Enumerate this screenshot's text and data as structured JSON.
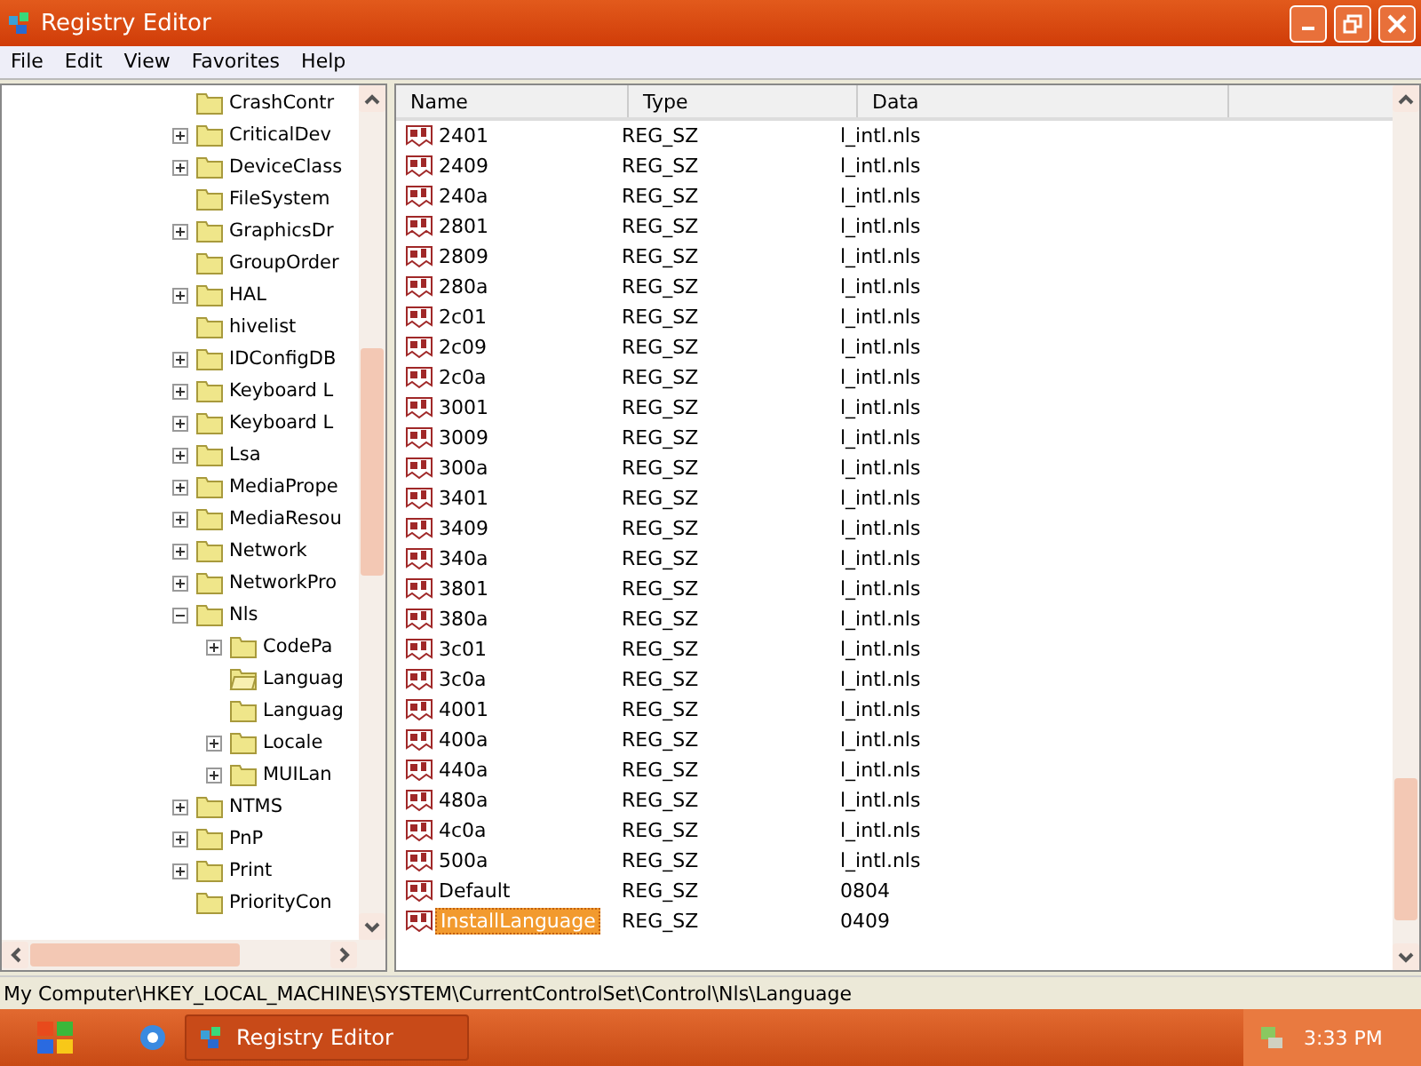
{
  "window": {
    "title": "Registry Editor"
  },
  "menu": [
    "File",
    "Edit",
    "View",
    "Favorites",
    "Help"
  ],
  "tree": [
    {
      "label": "CrashContr",
      "kind": "leaf"
    },
    {
      "label": "CriticalDev",
      "kind": "node",
      "expanded": false
    },
    {
      "label": "DeviceClass",
      "kind": "node",
      "expanded": false
    },
    {
      "label": "FileSystem",
      "kind": "leaf"
    },
    {
      "label": "GraphicsDr",
      "kind": "node",
      "expanded": false
    },
    {
      "label": "GroupOrder",
      "kind": "leaf"
    },
    {
      "label": "HAL",
      "kind": "node",
      "expanded": false
    },
    {
      "label": "hivelist",
      "kind": "leaf"
    },
    {
      "label": "IDConfigDB",
      "kind": "node",
      "expanded": false
    },
    {
      "label": "Keyboard L",
      "kind": "node",
      "expanded": false
    },
    {
      "label": "Keyboard L",
      "kind": "node",
      "expanded": false
    },
    {
      "label": "Lsa",
      "kind": "node",
      "expanded": false
    },
    {
      "label": "MediaPrope",
      "kind": "node",
      "expanded": false
    },
    {
      "label": "MediaResou",
      "kind": "node",
      "expanded": false
    },
    {
      "label": "Network",
      "kind": "node",
      "expanded": false
    },
    {
      "label": "NetworkPro",
      "kind": "node",
      "expanded": false
    },
    {
      "label": "Nls",
      "kind": "node",
      "expanded": true,
      "children": [
        {
          "label": "CodePa",
          "kind": "node",
          "expanded": false
        },
        {
          "label": "Languag",
          "kind": "leaf",
          "open": true
        },
        {
          "label": "Languag",
          "kind": "leaf"
        },
        {
          "label": "Locale",
          "kind": "node",
          "expanded": false
        },
        {
          "label": "MUILan",
          "kind": "node",
          "expanded": false
        }
      ]
    },
    {
      "label": "NTMS",
      "kind": "node",
      "expanded": false
    },
    {
      "label": "PnP",
      "kind": "node",
      "expanded": false
    },
    {
      "label": "Print",
      "kind": "node",
      "expanded": false
    },
    {
      "label": "PriorityCon",
      "kind": "leaf"
    }
  ],
  "columns": [
    "Name",
    "Type",
    "Data"
  ],
  "rows": [
    {
      "name": "2401",
      "type": "REG_SZ",
      "data": "l_intl.nls",
      "selected": false
    },
    {
      "name": "2409",
      "type": "REG_SZ",
      "data": "l_intl.nls",
      "selected": false
    },
    {
      "name": "240a",
      "type": "REG_SZ",
      "data": "l_intl.nls",
      "selected": false
    },
    {
      "name": "2801",
      "type": "REG_SZ",
      "data": "l_intl.nls",
      "selected": false
    },
    {
      "name": "2809",
      "type": "REG_SZ",
      "data": "l_intl.nls",
      "selected": false
    },
    {
      "name": "280a",
      "type": "REG_SZ",
      "data": "l_intl.nls",
      "selected": false
    },
    {
      "name": "2c01",
      "type": "REG_SZ",
      "data": "l_intl.nls",
      "selected": false
    },
    {
      "name": "2c09",
      "type": "REG_SZ",
      "data": "l_intl.nls",
      "selected": false
    },
    {
      "name": "2c0a",
      "type": "REG_SZ",
      "data": "l_intl.nls",
      "selected": false
    },
    {
      "name": "3001",
      "type": "REG_SZ",
      "data": "l_intl.nls",
      "selected": false
    },
    {
      "name": "3009",
      "type": "REG_SZ",
      "data": "l_intl.nls",
      "selected": false
    },
    {
      "name": "300a",
      "type": "REG_SZ",
      "data": "l_intl.nls",
      "selected": false
    },
    {
      "name": "3401",
      "type": "REG_SZ",
      "data": "l_intl.nls",
      "selected": false
    },
    {
      "name": "3409",
      "type": "REG_SZ",
      "data": "l_intl.nls",
      "selected": false
    },
    {
      "name": "340a",
      "type": "REG_SZ",
      "data": "l_intl.nls",
      "selected": false
    },
    {
      "name": "3801",
      "type": "REG_SZ",
      "data": "l_intl.nls",
      "selected": false
    },
    {
      "name": "380a",
      "type": "REG_SZ",
      "data": "l_intl.nls",
      "selected": false
    },
    {
      "name": "3c01",
      "type": "REG_SZ",
      "data": "l_intl.nls",
      "selected": false
    },
    {
      "name": "3c0a",
      "type": "REG_SZ",
      "data": "l_intl.nls",
      "selected": false
    },
    {
      "name": "4001",
      "type": "REG_SZ",
      "data": "l_intl.nls",
      "selected": false
    },
    {
      "name": "400a",
      "type": "REG_SZ",
      "data": "l_intl.nls",
      "selected": false
    },
    {
      "name": "440a",
      "type": "REG_SZ",
      "data": "l_intl.nls",
      "selected": false
    },
    {
      "name": "480a",
      "type": "REG_SZ",
      "data": "l_intl.nls",
      "selected": false
    },
    {
      "name": "4c0a",
      "type": "REG_SZ",
      "data": "l_intl.nls",
      "selected": false
    },
    {
      "name": "500a",
      "type": "REG_SZ",
      "data": "l_intl.nls",
      "selected": false
    },
    {
      "name": "Default",
      "type": "REG_SZ",
      "data": "0804",
      "selected": false
    },
    {
      "name": "InstallLanguage",
      "type": "REG_SZ",
      "data": "0409",
      "selected": true
    }
  ],
  "status_bar": "My Computer\\HKEY_LOCAL_MACHINE\\SYSTEM\\CurrentControlSet\\Control\\Nls\\Language",
  "taskbar": {
    "task": "Registry Editor",
    "clock": "3:33 PM"
  }
}
